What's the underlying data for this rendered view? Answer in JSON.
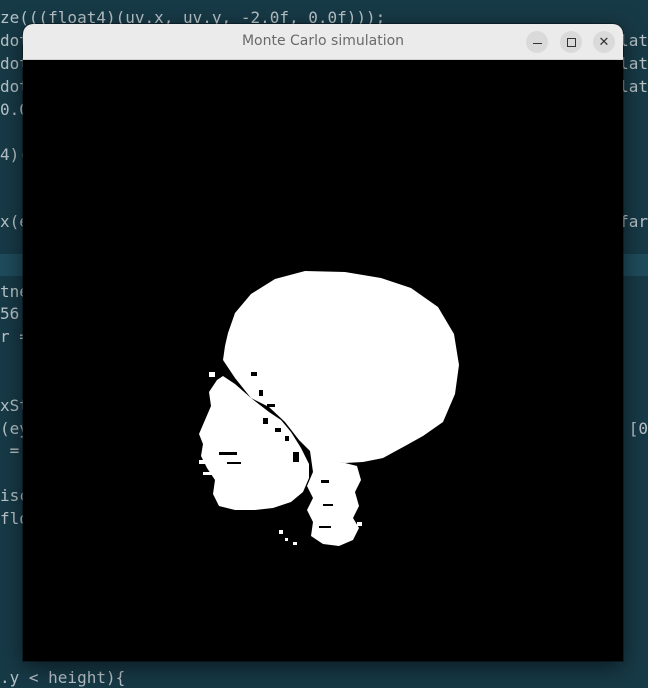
{
  "editor": {
    "lines": [
      "ze(((float4)(uv.x, uv.y, -2.0f, 0.0f)));",
      "dot",
      "dot",
      "dot",
      "0.0",
      "4)(",
      "x(e",
      "tne",
      "56",
      "r =",
      "xSt",
      "(ey",
      " =",
      "isc",
      "flo",
      ".y < height){"
    ],
    "right_fragments": [
      "lat",
      "lat",
      "lat",
      "far",
      "[0"
    ]
  },
  "window": {
    "title": "Monte Carlo simulation",
    "buttons": {
      "minimize_glyph": "",
      "maximize_glyph": "",
      "close_glyph": "✕"
    },
    "accent_background": "#000000",
    "render_color": "#ffffff"
  }
}
